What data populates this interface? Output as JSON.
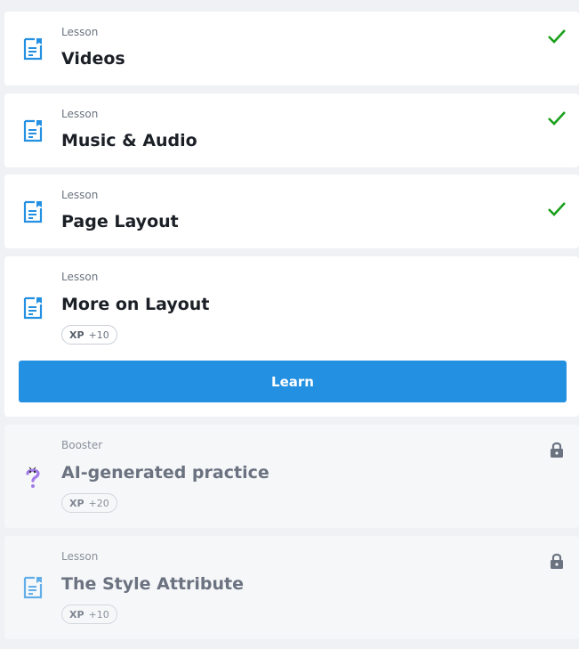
{
  "items": [
    {
      "kind": "Lesson",
      "title": "Videos",
      "status": "completed",
      "icon": "lesson-doc-icon"
    },
    {
      "kind": "Lesson",
      "title": "Music & Audio",
      "status": "completed",
      "icon": "lesson-doc-icon"
    },
    {
      "kind": "Lesson",
      "title": "Page Layout",
      "status": "completed",
      "icon": "lesson-doc-icon"
    },
    {
      "kind": "Lesson",
      "title": "More on Layout",
      "status": "current",
      "icon": "lesson-doc-icon",
      "xp_label": "XP",
      "xp_value": "+10",
      "button_label": "Learn"
    },
    {
      "kind": "Booster",
      "title": "AI-generated practice",
      "status": "locked",
      "icon": "question-mark-icon",
      "xp_label": "XP",
      "xp_value": "+20"
    },
    {
      "kind": "Lesson",
      "title": "The Style Attribute",
      "status": "locked",
      "icon": "lesson-doc-icon",
      "xp_label": "XP",
      "xp_value": "+10"
    }
  ],
  "colors": {
    "accent": "#2490e1",
    "check": "#1aa01a",
    "lock": "#6b7280"
  }
}
